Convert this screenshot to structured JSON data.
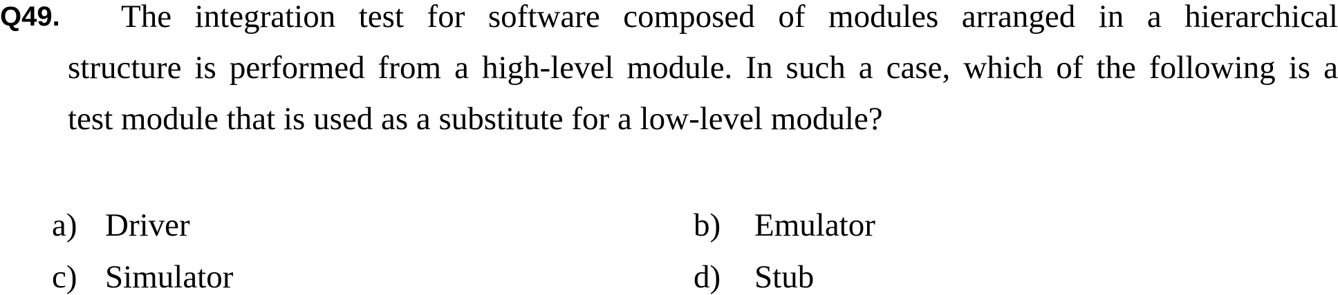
{
  "question": {
    "number": "Q49.",
    "lines": [
      "The integration test for software composed of modules arranged in a hierarchical",
      "structure is performed from a high-level module. In such a case, which of the following is a",
      "test module that is used as a substitute for a low-level module?"
    ]
  },
  "options": [
    {
      "letter": "a)",
      "text": "Driver"
    },
    {
      "letter": "b)",
      "text": "Emulator"
    },
    {
      "letter": "c)",
      "text": "Simulator"
    },
    {
      "letter": "d)",
      "text": "Stub"
    }
  ]
}
